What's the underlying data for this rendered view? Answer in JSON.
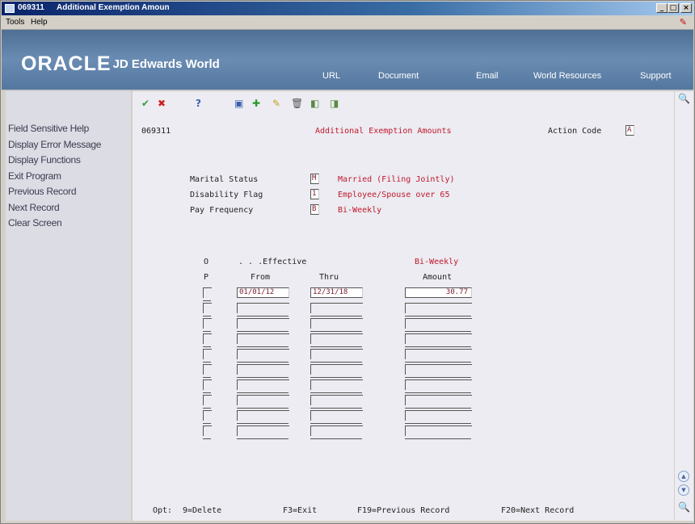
{
  "window": {
    "id": "069311",
    "title": "Additional Exemption Amoun",
    "controls": [
      "_",
      "□",
      "×"
    ]
  },
  "menu": {
    "items": [
      "Tools",
      "Help"
    ]
  },
  "header": {
    "logo_brand": "ORACLE",
    "logo_product": "JD Edwards World",
    "links": [
      "URL",
      "Document",
      "Email",
      "World Resources",
      "Support"
    ]
  },
  "sidebar": {
    "items": [
      "Field Sensitive Help",
      "Display Error Message",
      "Display Functions",
      "Exit Program",
      "Previous Record",
      "Next Record",
      "Clear Screen"
    ]
  },
  "toolbar": {
    "icons": [
      "check-icon",
      "cancel-icon",
      "help-icon",
      "inquire-icon",
      "add-icon",
      "change-icon",
      "delete-icon",
      "previous-icon",
      "next-icon"
    ]
  },
  "form": {
    "program_id": "069311",
    "screen_title": "Additional Exemption Amounts",
    "action_code_label": "Action Code",
    "action_code_value": "A",
    "marital_status": {
      "label": "Marital Status",
      "value": "M",
      "description": "Married (Filing Jointly)"
    },
    "disability_flag": {
      "label": "Disability Flag",
      "value": "1",
      "description": "Employee/Spouse over 65"
    },
    "pay_frequency": {
      "label": "Pay Frequency",
      "value": "B",
      "description": "Bi-Weekly"
    }
  },
  "grid": {
    "header_o": "O",
    "header_p": "P",
    "header_effective": ". . .Effective",
    "header_from": "From",
    "header_thru": "Thru",
    "header_amount_top": "Bi-Weekly",
    "header_amount": "Amount",
    "rows": [
      {
        "opt": "",
        "from": "01/01/12",
        "thru": "12/31/18",
        "amount": "30.77"
      }
    ],
    "empty_rows": 9
  },
  "footer": {
    "opt": "Opt:",
    "delete": "9=Delete",
    "exit": "F3=Exit",
    "previous": "F19=Previous Record",
    "next": "F20=Next Record"
  }
}
